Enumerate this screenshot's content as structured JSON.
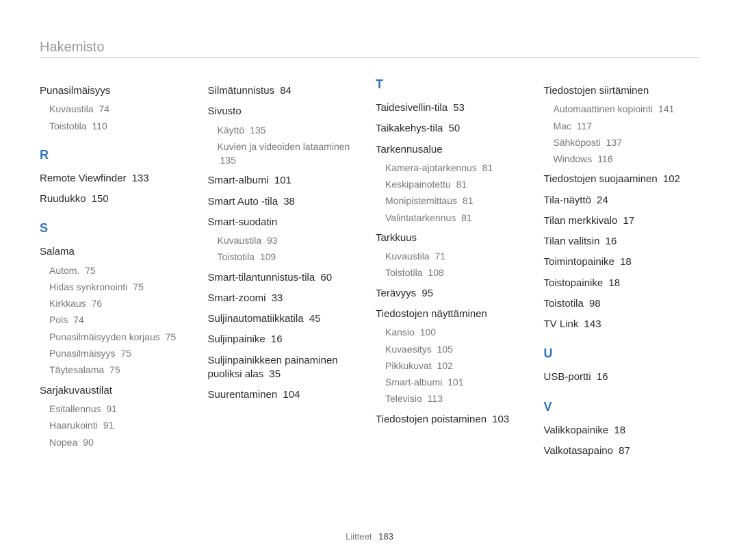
{
  "title": "Hakemisto",
  "footer": {
    "label": "Liitteet",
    "page": "183"
  },
  "cols": [
    {
      "groups": [
        {
          "heading": {
            "text": "Punasilmäisyys",
            "page": ""
          },
          "subs": [
            {
              "text": "Kuvaustila",
              "page": "74"
            },
            {
              "text": "Toistotila",
              "page": "110"
            }
          ]
        },
        {
          "letter": "R"
        },
        {
          "heading": {
            "text": "Remote Viewfinder",
            "page": "133"
          }
        },
        {
          "heading": {
            "text": "Ruudukko",
            "page": "150"
          }
        },
        {
          "letter": "S"
        },
        {
          "heading": {
            "text": "Salama",
            "page": ""
          },
          "subs": [
            {
              "text": "Autom.",
              "page": "75"
            },
            {
              "text": "Hidas synkronointi",
              "page": "75"
            },
            {
              "text": "Kirkkaus",
              "page": "76"
            },
            {
              "text": "Pois",
              "page": "74"
            },
            {
              "text": "Punasilmäisyyden korjaus",
              "page": "75"
            },
            {
              "text": "Punasilmäisyys",
              "page": "75"
            },
            {
              "text": "Täytesalama",
              "page": "75"
            }
          ]
        },
        {
          "heading": {
            "text": "Sarjakuvaustilat",
            "page": ""
          },
          "subs": [
            {
              "text": "Esitallennus",
              "page": "91"
            },
            {
              "text": "Haarukointi",
              "page": "91"
            },
            {
              "text": "Nopea",
              "page": "90"
            }
          ]
        }
      ]
    },
    {
      "groups": [
        {
          "heading": {
            "text": "Silmätunnistus",
            "page": "84"
          }
        },
        {
          "heading": {
            "text": "Sivusto",
            "page": ""
          },
          "subs": [
            {
              "text": "Käyttö",
              "page": "135"
            },
            {
              "text": "Kuvien ja videoiden lataaminen",
              "page": "135"
            }
          ]
        },
        {
          "heading": {
            "text": "Smart-albumi",
            "page": "101"
          }
        },
        {
          "heading": {
            "text": "Smart Auto -tila",
            "page": "38"
          }
        },
        {
          "heading": {
            "text": "Smart-suodatin",
            "page": ""
          },
          "subs": [
            {
              "text": "Kuvaustila",
              "page": "93"
            },
            {
              "text": "Toistotila",
              "page": "109"
            }
          ]
        },
        {
          "heading": {
            "text": "Smart-tilantunnistus-tila",
            "page": "60"
          }
        },
        {
          "heading": {
            "text": "Smart-zoomi",
            "page": "33"
          }
        },
        {
          "heading": {
            "text": "Suljinautomatiikkatila",
            "page": "45"
          }
        },
        {
          "heading": {
            "text": "Suljinpainike",
            "page": "16"
          }
        },
        {
          "heading": {
            "text": "Suljinpainikkeen painaminen puoliksi alas",
            "page": "35"
          }
        },
        {
          "heading": {
            "text": "Suurentaminen",
            "page": "104"
          }
        }
      ]
    },
    {
      "groups": [
        {
          "letter": "T"
        },
        {
          "heading": {
            "text": "Taidesivellin-tila",
            "page": "53"
          }
        },
        {
          "heading": {
            "text": "Taikakehys-tila",
            "page": "50"
          }
        },
        {
          "heading": {
            "text": "Tarkennusalue",
            "page": ""
          },
          "subs": [
            {
              "text": "Kamera-ajotarkennus",
              "page": "81"
            },
            {
              "text": "Keskipainotettu",
              "page": "81"
            },
            {
              "text": "Monipistemittaus",
              "page": "81"
            },
            {
              "text": "Valintatarkennus",
              "page": "81"
            }
          ]
        },
        {
          "heading": {
            "text": "Tarkkuus",
            "page": ""
          },
          "subs": [
            {
              "text": "Kuvaustila",
              "page": "71"
            },
            {
              "text": "Toistotila",
              "page": "108"
            }
          ]
        },
        {
          "heading": {
            "text": "Terävyys",
            "page": "95"
          }
        },
        {
          "heading": {
            "text": "Tiedostojen näyttäminen",
            "page": ""
          },
          "subs": [
            {
              "text": "Kansio",
              "page": "100"
            },
            {
              "text": "Kuvaesitys",
              "page": "105"
            },
            {
              "text": "Pikkukuvat",
              "page": "102"
            },
            {
              "text": "Smart-albumi",
              "page": "101"
            },
            {
              "text": "Televisio",
              "page": "113"
            }
          ]
        },
        {
          "heading": {
            "text": "Tiedostojen poistaminen",
            "page": "103"
          }
        }
      ]
    },
    {
      "groups": [
        {
          "heading": {
            "text": "Tiedostojen siirtäminen",
            "page": ""
          },
          "subs": [
            {
              "text": "Automaattinen kopiointi",
              "page": "141"
            },
            {
              "text": "Mac",
              "page": "117"
            },
            {
              "text": "Sähköposti",
              "page": "137"
            },
            {
              "text": "Windows",
              "page": "116"
            }
          ]
        },
        {
          "heading": {
            "text": "Tiedostojen suojaaminen",
            "page": "102"
          }
        },
        {
          "heading": {
            "text": "Tila-näyttö",
            "page": "24"
          }
        },
        {
          "heading": {
            "text": "Tilan merkkivalo",
            "page": "17"
          }
        },
        {
          "heading": {
            "text": "Tilan valitsin",
            "page": "16"
          }
        },
        {
          "heading": {
            "text": "Toimintopainike",
            "page": "18"
          }
        },
        {
          "heading": {
            "text": "Toistopainike",
            "page": "18"
          }
        },
        {
          "heading": {
            "text": "Toistotila",
            "page": "98"
          }
        },
        {
          "heading": {
            "text": "TV Link",
            "page": "143"
          }
        },
        {
          "letter": "U"
        },
        {
          "heading": {
            "text": "USB-portti",
            "page": "16"
          }
        },
        {
          "letter": "V"
        },
        {
          "heading": {
            "text": "Valikkopainike",
            "page": "18"
          }
        },
        {
          "heading": {
            "text": "Valkotasapaino",
            "page": "87"
          }
        }
      ]
    }
  ]
}
